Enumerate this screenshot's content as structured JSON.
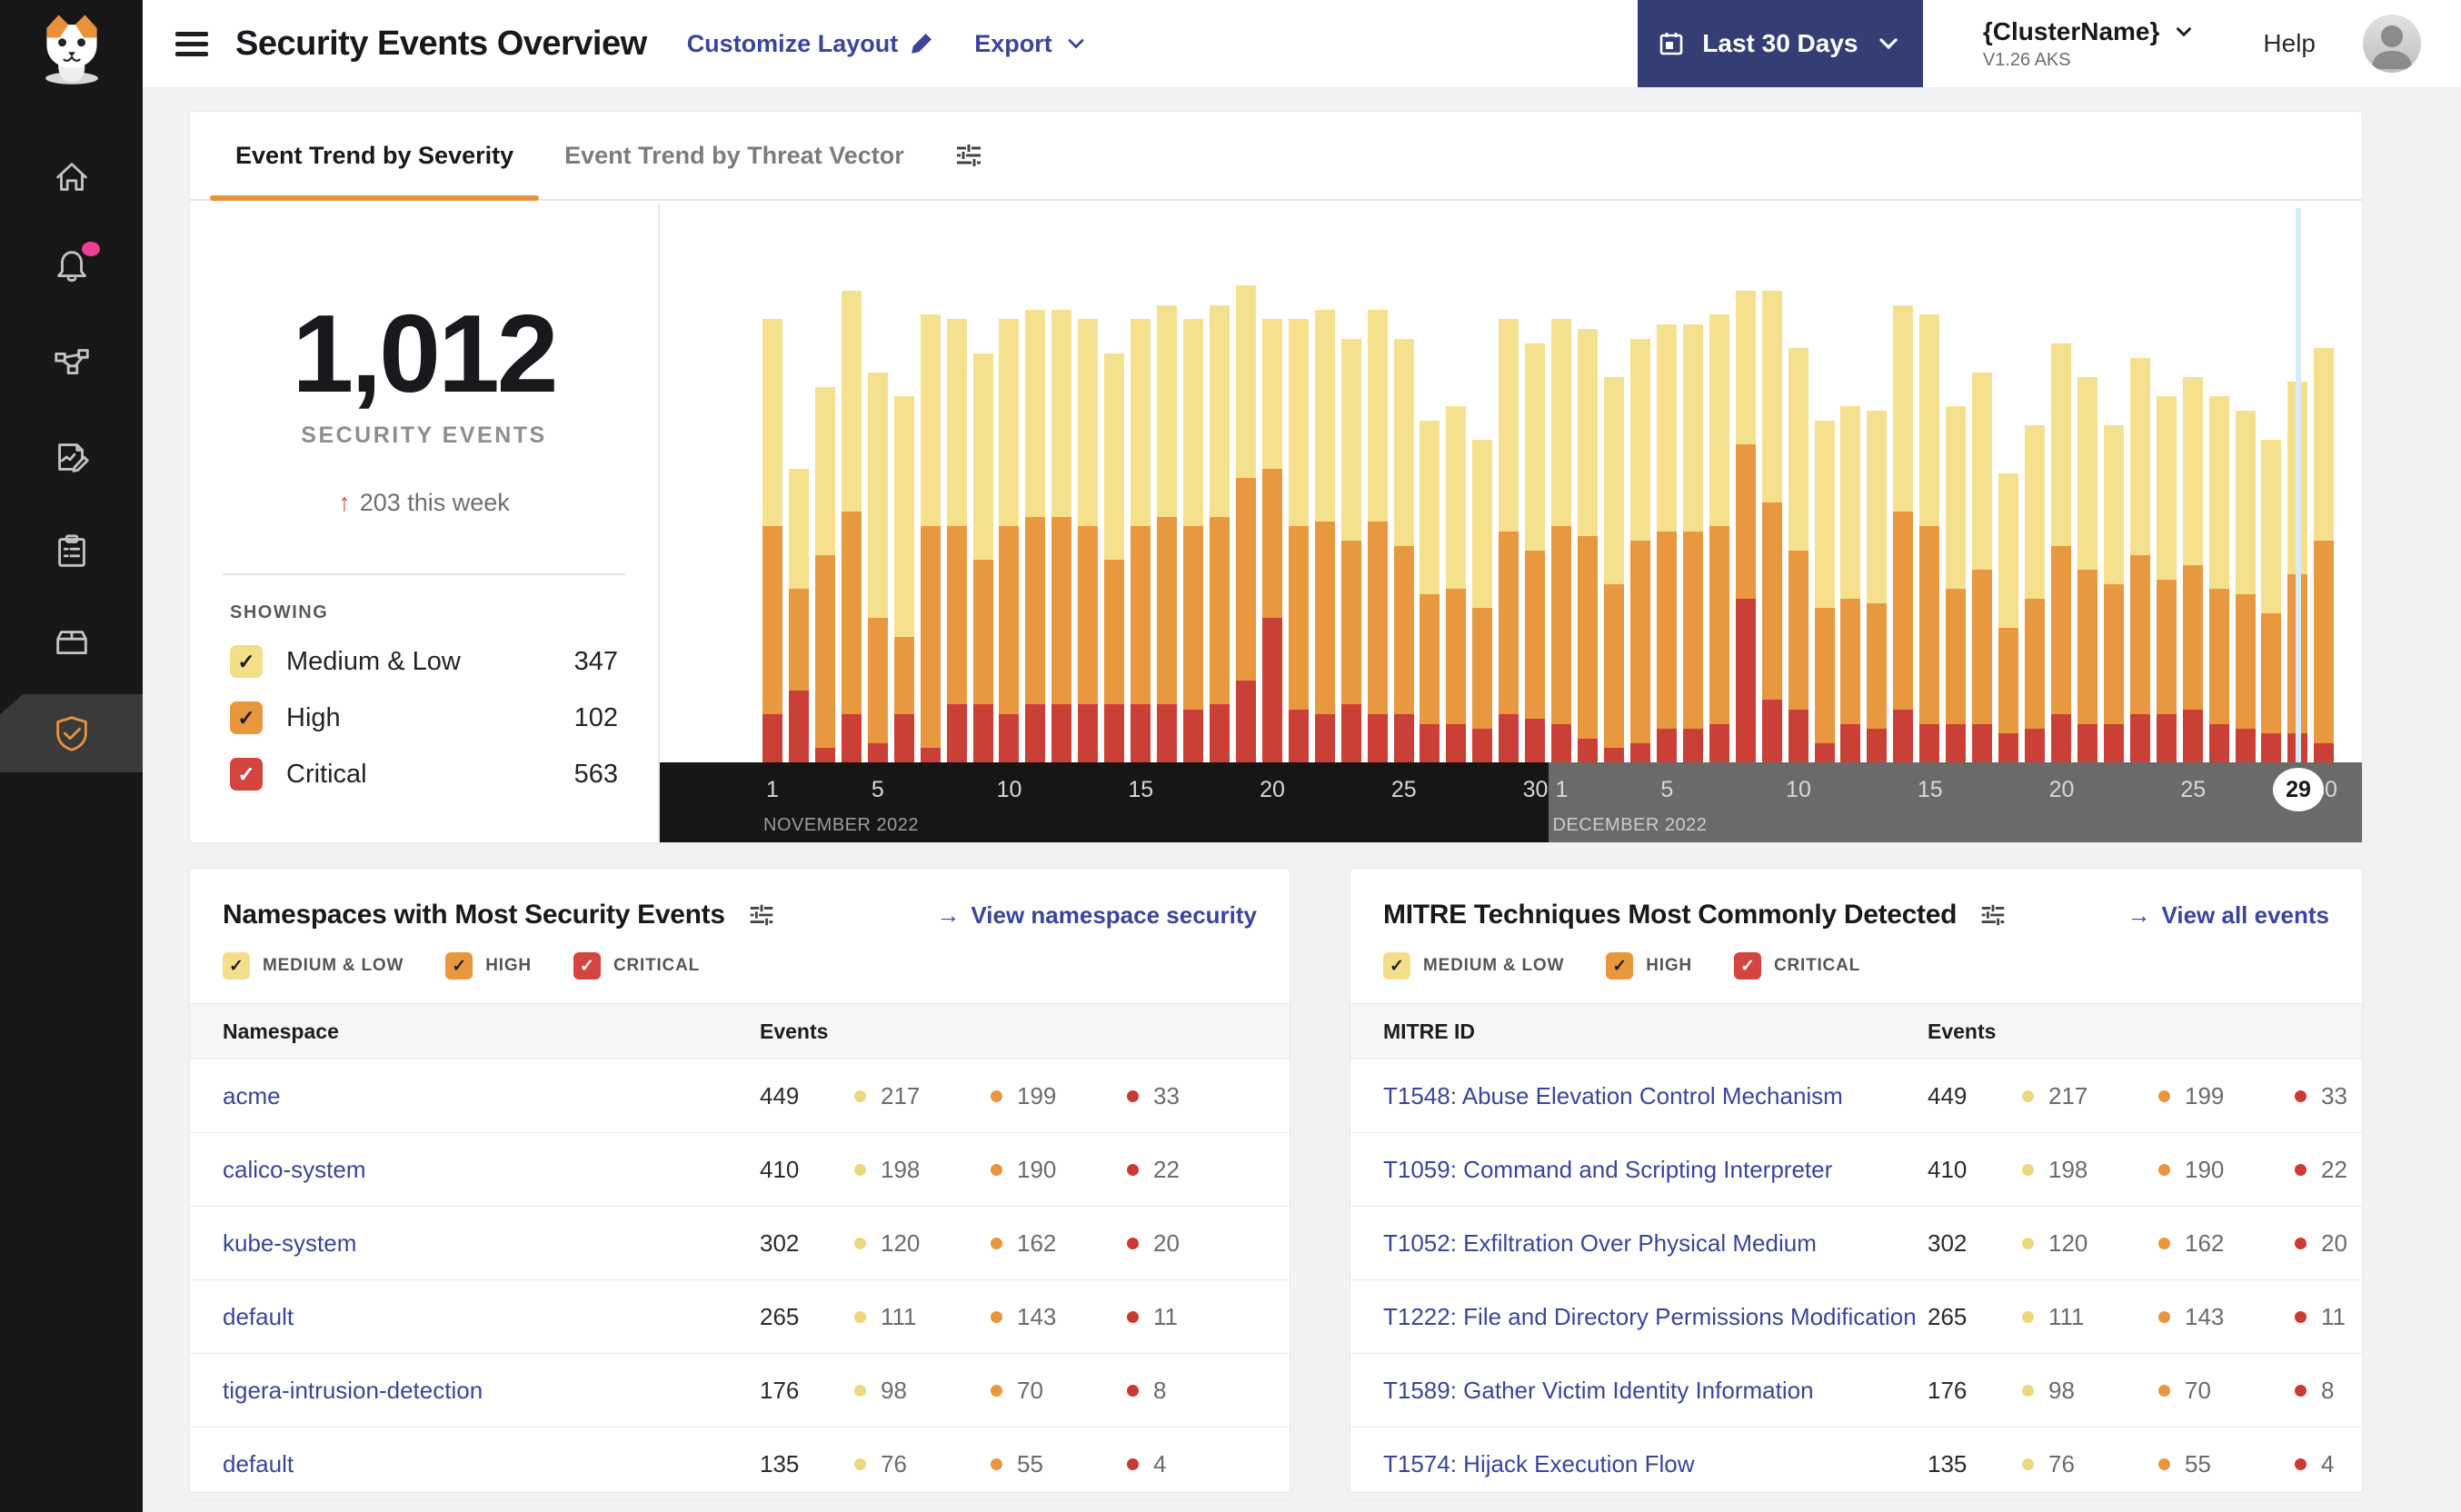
{
  "header": {
    "title": "Security Events Overview",
    "customize_layout": "Customize Layout",
    "export": "Export",
    "date_range": "Last 30 Days",
    "cluster_name": "{ClusterName}",
    "cluster_version": "V1.26 AKS",
    "help": "Help"
  },
  "sidebar": {
    "items": [
      "home",
      "notifications",
      "service-graph",
      "reports",
      "compliance",
      "workloads",
      "threat-defense"
    ],
    "active_item": "threat-defense"
  },
  "tabs": [
    {
      "label": "Event Trend by Severity",
      "active": true
    },
    {
      "label": "Event Trend by Threat Vector",
      "active": false
    }
  ],
  "stats": {
    "total": "1,012",
    "label": "SECURITY EVENTS",
    "delta_arrow": "↑",
    "delta": "203 this week",
    "showing_label": "SHOWING"
  },
  "severity_legend": [
    {
      "key": "medium_low",
      "label": "Medium & Low",
      "filter_label": "MEDIUM & LOW",
      "count": "347",
      "color": "#F5DE8A",
      "check_color": "#1d1d1d"
    },
    {
      "key": "high",
      "label": "High",
      "filter_label": "HIGH",
      "count": "102",
      "color": "#E8973C",
      "check_color": "#1d1d1d"
    },
    {
      "key": "critical",
      "label": "Critical",
      "filter_label": "CRITICAL",
      "count": "563",
      "color": "#D5453F",
      "check_color": "#ffffff"
    }
  ],
  "chart_data": {
    "type": "bar",
    "stacked": true,
    "unit": "percent-of-plot-height",
    "series_names": [
      "medium_low",
      "high",
      "critical"
    ],
    "colors": {
      "medium_low": "#F5E18D",
      "high": "#E8983E",
      "critical": "#CB4036"
    },
    "dot_colors": {
      "medium_low": "#EFD77E",
      "high": "#E8973C",
      "critical": "#CB3A31"
    },
    "months": [
      {
        "label": "NOVEMBER 2022",
        "start_index": 0,
        "days": 30,
        "ticks": [
          1,
          5,
          10,
          15,
          20,
          25,
          30
        ]
      },
      {
        "label": "DECEMBER 2022",
        "start_index": 30,
        "days": 30,
        "ticks": [
          1,
          5,
          10,
          15,
          20,
          25,
          30
        ]
      }
    ],
    "highlight_day": {
      "month_index": 1,
      "day": 29,
      "label": "29"
    },
    "days": [
      {
        "d": "Nov 1",
        "v": [
          43,
          39,
          10
        ]
      },
      {
        "d": "Nov 2",
        "v": [
          25,
          21,
          15
        ]
      },
      {
        "d": "Nov 3",
        "v": [
          35,
          40,
          3
        ]
      },
      {
        "d": "Nov 4",
        "v": [
          46,
          42,
          10
        ]
      },
      {
        "d": "Nov 5",
        "v": [
          51,
          26,
          4
        ]
      },
      {
        "d": "Nov 6",
        "v": [
          50,
          16,
          10
        ]
      },
      {
        "d": "Nov 7",
        "v": [
          44,
          46,
          3
        ]
      },
      {
        "d": "Nov 8",
        "v": [
          43,
          37,
          12
        ]
      },
      {
        "d": "Nov 9",
        "v": [
          43,
          30,
          12
        ]
      },
      {
        "d": "Nov 10",
        "v": [
          43,
          39,
          10
        ]
      },
      {
        "d": "Nov 11",
        "v": [
          43,
          39,
          12
        ]
      },
      {
        "d": "Nov 12",
        "v": [
          43,
          39,
          12
        ]
      },
      {
        "d": "Nov 13",
        "v": [
          43,
          37,
          12
        ]
      },
      {
        "d": "Nov 14",
        "v": [
          43,
          30,
          12
        ]
      },
      {
        "d": "Nov 15",
        "v": [
          43,
          37,
          12
        ]
      },
      {
        "d": "Nov 16",
        "v": [
          44,
          39,
          12
        ]
      },
      {
        "d": "Nov 17",
        "v": [
          43,
          38,
          11
        ]
      },
      {
        "d": "Nov 18",
        "v": [
          44,
          39,
          12
        ]
      },
      {
        "d": "Nov 19",
        "v": [
          40,
          42,
          17
        ]
      },
      {
        "d": "Nov 20",
        "v": [
          31,
          31,
          30
        ]
      },
      {
        "d": "Nov 21",
        "v": [
          43,
          38,
          11
        ]
      },
      {
        "d": "Nov 22",
        "v": [
          44,
          40,
          10
        ]
      },
      {
        "d": "Nov 23",
        "v": [
          42,
          34,
          12
        ]
      },
      {
        "d": "Nov 24",
        "v": [
          44,
          40,
          10
        ]
      },
      {
        "d": "Nov 25",
        "v": [
          43,
          35,
          10
        ]
      },
      {
        "d": "Nov 26",
        "v": [
          36,
          27,
          8
        ]
      },
      {
        "d": "Nov 27",
        "v": [
          38,
          28,
          8
        ]
      },
      {
        "d": "Nov 28",
        "v": [
          35,
          25,
          7
        ]
      },
      {
        "d": "Nov 29",
        "v": [
          44,
          38,
          10
        ]
      },
      {
        "d": "Nov 30",
        "v": [
          43,
          35,
          9
        ]
      },
      {
        "d": "Dec 1",
        "v": [
          43,
          41,
          8
        ]
      },
      {
        "d": "Dec 2",
        "v": [
          43,
          42,
          5
        ]
      },
      {
        "d": "Dec 3",
        "v": [
          43,
          34,
          3
        ]
      },
      {
        "d": "Dec 4",
        "v": [
          42,
          42,
          4
        ]
      },
      {
        "d": "Dec 5",
        "v": [
          43,
          41,
          7
        ]
      },
      {
        "d": "Dec 6",
        "v": [
          43,
          41,
          7
        ]
      },
      {
        "d": "Dec 7",
        "v": [
          44,
          41,
          8
        ]
      },
      {
        "d": "Dec 8",
        "v": [
          32,
          32,
          34
        ]
      },
      {
        "d": "Dec 9",
        "v": [
          44,
          41,
          13
        ]
      },
      {
        "d": "Dec 10",
        "v": [
          42,
          33,
          11
        ]
      },
      {
        "d": "Dec 11",
        "v": [
          39,
          28,
          4
        ]
      },
      {
        "d": "Dec 12",
        "v": [
          40,
          26,
          8
        ]
      },
      {
        "d": "Dec 13",
        "v": [
          40,
          26,
          7
        ]
      },
      {
        "d": "Dec 14",
        "v": [
          43,
          41,
          11
        ]
      },
      {
        "d": "Dec 15",
        "v": [
          44,
          41,
          8
        ]
      },
      {
        "d": "Dec 16",
        "v": [
          38,
          28,
          8
        ]
      },
      {
        "d": "Dec 17",
        "v": [
          41,
          32,
          8
        ]
      },
      {
        "d": "Dec 18",
        "v": [
          32,
          22,
          6
        ]
      },
      {
        "d": "Dec 19",
        "v": [
          36,
          27,
          7
        ]
      },
      {
        "d": "Dec 20",
        "v": [
          42,
          35,
          10
        ]
      },
      {
        "d": "Dec 21",
        "v": [
          40,
          32,
          8
        ]
      },
      {
        "d": "Dec 22",
        "v": [
          33,
          29,
          8
        ]
      },
      {
        "d": "Dec 23",
        "v": [
          41,
          33,
          10
        ]
      },
      {
        "d": "Dec 24",
        "v": [
          38,
          28,
          10
        ]
      },
      {
        "d": "Dec 25",
        "v": [
          39,
          30,
          11
        ]
      },
      {
        "d": "Dec 26",
        "v": [
          40,
          28,
          8
        ]
      },
      {
        "d": "Dec 27",
        "v": [
          38,
          28,
          7
        ]
      },
      {
        "d": "Dec 28",
        "v": [
          36,
          25,
          6
        ]
      },
      {
        "d": "Dec 29",
        "v": [
          40,
          33,
          6
        ]
      },
      {
        "d": "Dec 30",
        "v": [
          40,
          42,
          4
        ]
      }
    ]
  },
  "namespace_card": {
    "title": "Namespaces with Most Security Events",
    "link_label": "View namespace security",
    "link_arrow": "→",
    "columns": [
      "Namespace",
      "Events"
    ],
    "rows": [
      {
        "name": "acme",
        "total": "449",
        "medium_low": "217",
        "high": "199",
        "critical": "33"
      },
      {
        "name": "calico-system",
        "total": "410",
        "medium_low": "198",
        "high": "190",
        "critical": "22"
      },
      {
        "name": "kube-system",
        "total": "302",
        "medium_low": "120",
        "high": "162",
        "critical": "20"
      },
      {
        "name": "default",
        "total": "265",
        "medium_low": "111",
        "high": "143",
        "critical": "11"
      },
      {
        "name": "tigera-intrusion-detection",
        "total": "176",
        "medium_low": "98",
        "high": "70",
        "critical": "8"
      },
      {
        "name": "default",
        "total": "135",
        "medium_low": "76",
        "high": "55",
        "critical": "4"
      }
    ]
  },
  "mitre_card": {
    "title": "MITRE Techniques Most Commonly Detected",
    "link_label": "View all events",
    "link_arrow": "→",
    "columns": [
      "MITRE ID",
      "Events"
    ],
    "rows": [
      {
        "name": "T1548: Abuse Elevation Control Mechanism",
        "total": "449",
        "medium_low": "217",
        "high": "199",
        "critical": "33"
      },
      {
        "name": "T1059: Command and Scripting Interpreter",
        "total": "410",
        "medium_low": "198",
        "high": "190",
        "critical": "22"
      },
      {
        "name": "T1052: Exfiltration Over Physical Medium",
        "total": "302",
        "medium_low": "120",
        "high": "162",
        "critical": "20"
      },
      {
        "name": "T1222: File and Directory Permissions Modification",
        "total": "265",
        "medium_low": "111",
        "high": "143",
        "critical": "11"
      },
      {
        "name": "T1589: Gather Victim Identity Information",
        "total": "176",
        "medium_low": "98",
        "high": "70",
        "critical": "8"
      },
      {
        "name": "T1574: Hijack Execution Flow",
        "total": "135",
        "medium_low": "76",
        "high": "55",
        "critical": "4"
      }
    ]
  }
}
